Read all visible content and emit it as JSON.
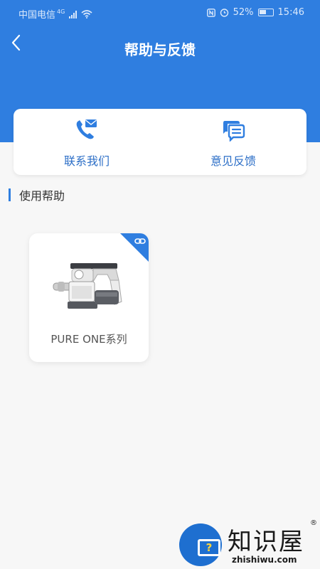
{
  "statusbar": {
    "carrier": "中国电信",
    "network": "4G",
    "battery": "52%",
    "time": "15:46"
  },
  "header": {
    "title": "帮助与反馈",
    "back_icon": "chevron-left-icon"
  },
  "quick_actions": [
    {
      "label": "联系我们",
      "icon": "phone-mail-icon"
    },
    {
      "label": "意见反馈",
      "icon": "chat-bubble-icon"
    }
  ],
  "section": {
    "title": "使用帮助"
  },
  "products": [
    {
      "name": "PURE ONE系列",
      "badge_icon": "link-icon"
    }
  ],
  "watermark": {
    "text": "知识屋",
    "url": "zhishiwu.com",
    "registered": "®"
  },
  "colors": {
    "primary": "#2f7ee0",
    "background": "#f7f7f7",
    "accent_text": "#2d6fc7"
  }
}
